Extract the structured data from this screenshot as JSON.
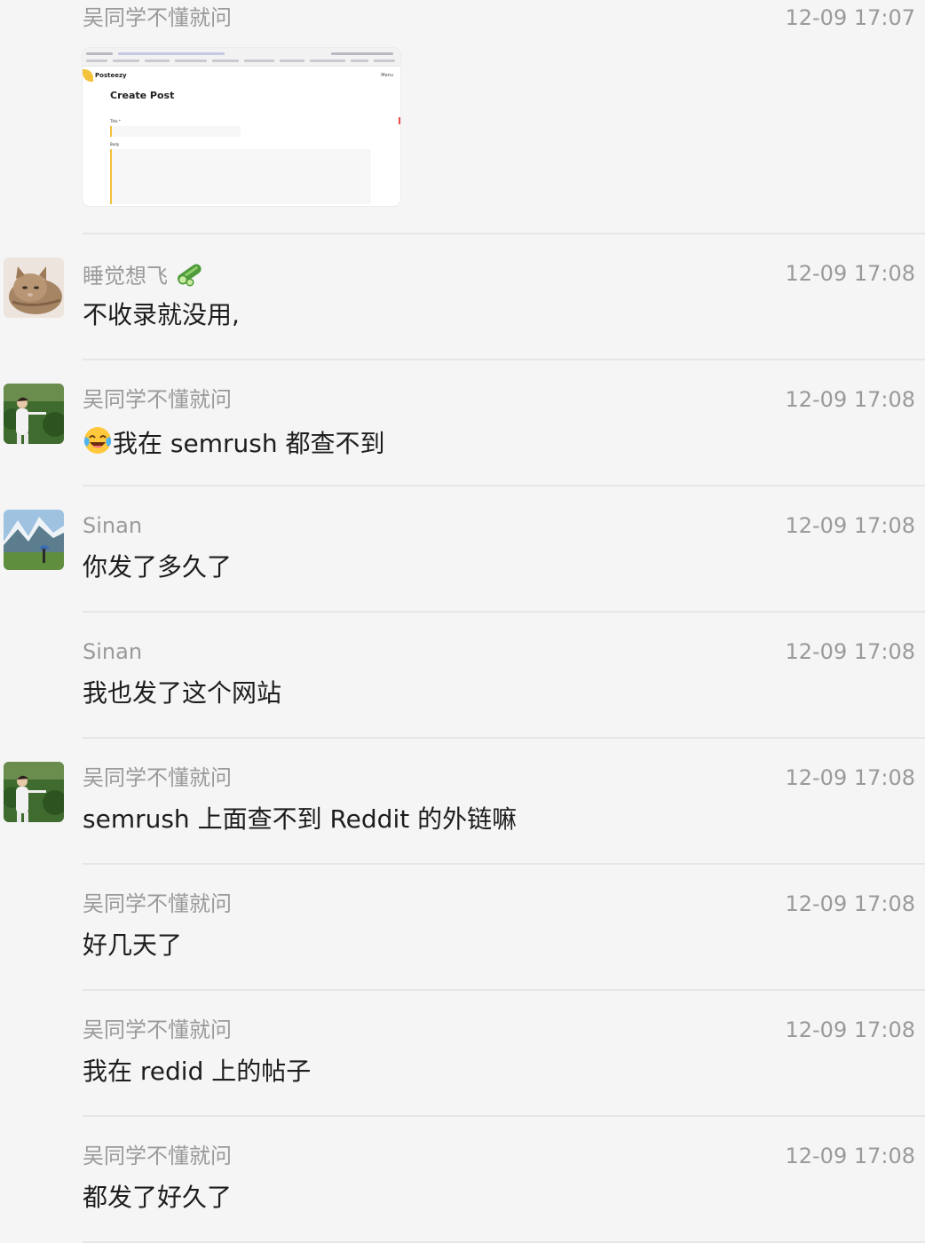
{
  "messages": [
    {
      "sender": "吴同学不懂就问",
      "time": "12-09 17:07",
      "text": "",
      "has_image": true
    },
    {
      "sender": "睡觉想飞",
      "sender_icon": "cucumber-emoji",
      "time": "12-09 17:08",
      "text": "不收录就没用,"
    },
    {
      "sender": "吴同学不懂就问",
      "time": "12-09 17:08",
      "emoji": "tears-of-joy-emoji",
      "text": "我在 semrush 都查不到"
    },
    {
      "sender": "Sinan",
      "time": "12-09 17:08",
      "text": "你发了多久了"
    },
    {
      "sender": "Sinan",
      "time": "12-09 17:08",
      "text": "我也发了这个网站"
    },
    {
      "sender": "吴同学不懂就问",
      "time": "12-09 17:08",
      "text": "semrush 上面查不到 Reddit 的外链嘛"
    },
    {
      "sender": "吴同学不懂就问",
      "time": "12-09 17:08",
      "text": "好几天了"
    },
    {
      "sender": "吴同学不懂就问",
      "time": "12-09 17:08",
      "text": "我在 redid 上的帖子"
    },
    {
      "sender": "吴同学不懂就问",
      "time": "12-09 17:08",
      "text": "都发了好久了"
    }
  ],
  "screenshot_preview": {
    "brand": "Posteezy",
    "menu": "Menu",
    "heading": "Create Post",
    "title_label": "Title *",
    "body_label": "Body"
  },
  "colors": {
    "background": "#f5f5f5",
    "meta_text": "#9a9a9a",
    "message_text": "#1d1d1d",
    "separator": "#e6e6e6",
    "brand_accent": "#f3c23b"
  }
}
